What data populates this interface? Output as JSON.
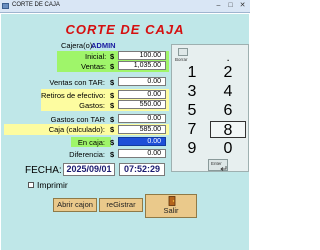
{
  "window": {
    "title": "CORTE DE CAJA",
    "minimize": "–",
    "maximize": "□",
    "close": "✕"
  },
  "heading": "CORTE DE CAJA",
  "cashier": {
    "label": "Cajera(o):",
    "value": "ADMIN"
  },
  "rows": {
    "inicial": {
      "label": "Inicial:",
      "currency": "$",
      "value": "100.00"
    },
    "ventas": {
      "label": "Ventas:",
      "currency": "$",
      "value": "1,035.00"
    },
    "ventas_tar": {
      "label": "Ventas con TAR:",
      "currency": "$",
      "value": "0.00"
    },
    "retiros": {
      "label": "Retiros de efectivo:",
      "currency": "$",
      "value": "0.00"
    },
    "gastos": {
      "label": "Gastos:",
      "currency": "$",
      "value": "550.00"
    },
    "gastos_tar": {
      "label": "Gastos con TAR",
      "currency": "$",
      "value": "0.00"
    },
    "caja_calc": {
      "label": "Caja (calculado):",
      "currency": "$",
      "value": "585.00"
    },
    "en_caja": {
      "label": "En caja:",
      "currency": "$",
      "value": "0.00"
    },
    "diferencia": {
      "label": "Diferencia:",
      "currency": "$",
      "value": "0.00"
    }
  },
  "fecha": {
    "label": "FECHA:",
    "date": "2025/09/01",
    "time": "07:52:29"
  },
  "imprimir": {
    "label": "Imprimir",
    "checked": false
  },
  "buttons": {
    "abrir": "Abrir cajon",
    "registrar": "reGistrar",
    "salir": "Salir"
  },
  "keypad": {
    "borrar": "Borrar",
    "punto": ".",
    "keys": [
      "1",
      "2",
      "3",
      "4",
      "5",
      "6",
      "7",
      "8",
      "9",
      "0"
    ],
    "selected": "8",
    "enter_label": "Enter"
  }
}
